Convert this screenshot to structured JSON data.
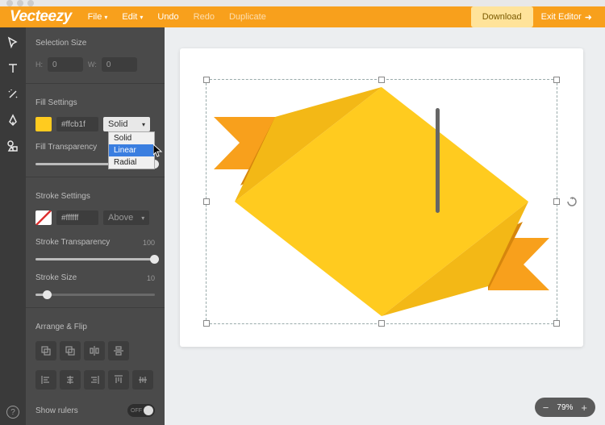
{
  "header": {
    "logo": "Vecteezy",
    "menu_file": "File",
    "menu_edit": "Edit",
    "menu_undo": "Undo",
    "menu_redo": "Redo",
    "menu_duplicate": "Duplicate",
    "download": "Download",
    "exit": "Exit Editor"
  },
  "sidebar": {
    "selection_size": "Selection Size",
    "h_label": "H:",
    "w_label": "W:",
    "h_value": "0",
    "w_value": "0",
    "fill_settings": "Fill Settings",
    "fill_hex": "#ffcb1f",
    "fill_type_value": "Solid",
    "fill_type_options": [
      "Solid",
      "Linear",
      "Radial"
    ],
    "fill_transparency": "Fill Transparency",
    "stroke_settings": "Stroke Settings",
    "stroke_hex": "#ffffff",
    "stroke_pos": "Above",
    "stroke_transparency": "Stroke Transparency",
    "stroke_transparency_val": "100",
    "stroke_size": "Stroke Size",
    "stroke_size_val": "10",
    "arrange_flip": "Arrange & Flip",
    "show_rulers": "Show rulers",
    "toggle_off": "OFF"
  },
  "colors": {
    "accent": "#f8a01c",
    "fill": "#ffcb1f"
  },
  "zoom": {
    "value": "79%"
  }
}
